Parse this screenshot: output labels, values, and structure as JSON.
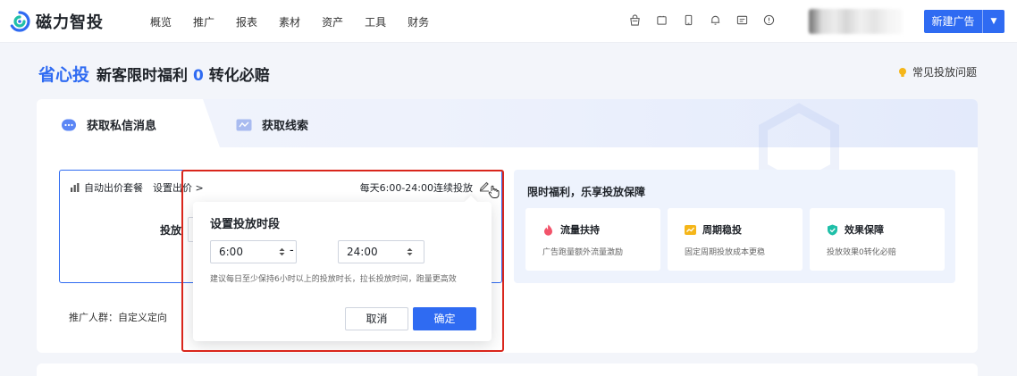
{
  "app": {
    "name": "磁力智投"
  },
  "nav": {
    "items": [
      "概览",
      "推广",
      "报表",
      "素材",
      "资产",
      "工具",
      "财务"
    ],
    "icons": [
      "shop-icon",
      "tablet-icon",
      "phone-icon",
      "bell-icon",
      "message-icon",
      "help-icon"
    ],
    "new_ad_label": "新建广告",
    "new_ad_caret": "▼"
  },
  "page": {
    "brand_title": "省心投",
    "promo_prefix": "新客限时福利 ",
    "promo_number": "0",
    "promo_suffix": " 转化必赔",
    "faq_label": "常见投放问题"
  },
  "tabs": [
    {
      "label": "获取私信消息",
      "active": true
    },
    {
      "label": "获取线索",
      "active": false
    }
  ],
  "config": {
    "package_label": "自动出价套餐",
    "set_bid_label": "设置出价 >",
    "schedule_text": "每天6:00-24:00连续投放",
    "budget_label": "投放",
    "audience_label": "推广人群：自定义定向"
  },
  "benefits": {
    "title": "限时福利，乐享投放保障",
    "items": [
      {
        "name": "流量扶持",
        "desc": "广告跑量额外流量激励",
        "icon": "flame-icon",
        "color": "#f2536a"
      },
      {
        "name": "周期稳投",
        "desc": "固定周期投放成本更稳",
        "icon": "trend-icon",
        "color": "#f5b619"
      },
      {
        "name": "效果保障",
        "desc": "投放效果0转化必赔",
        "icon": "shield-icon",
        "color": "#1fbfa8"
      }
    ]
  },
  "popover": {
    "title": "设置投放时段",
    "start_time": "6:00",
    "separator": "-",
    "end_time": "24:00",
    "hint": "建议每日至少保持6小时以上的投放时长，拉长投放时间，跑量更高效",
    "cancel_label": "取消",
    "confirm_label": "确定"
  },
  "colors": {
    "primary": "#2f6bf2",
    "highlight": "#d9261c"
  }
}
